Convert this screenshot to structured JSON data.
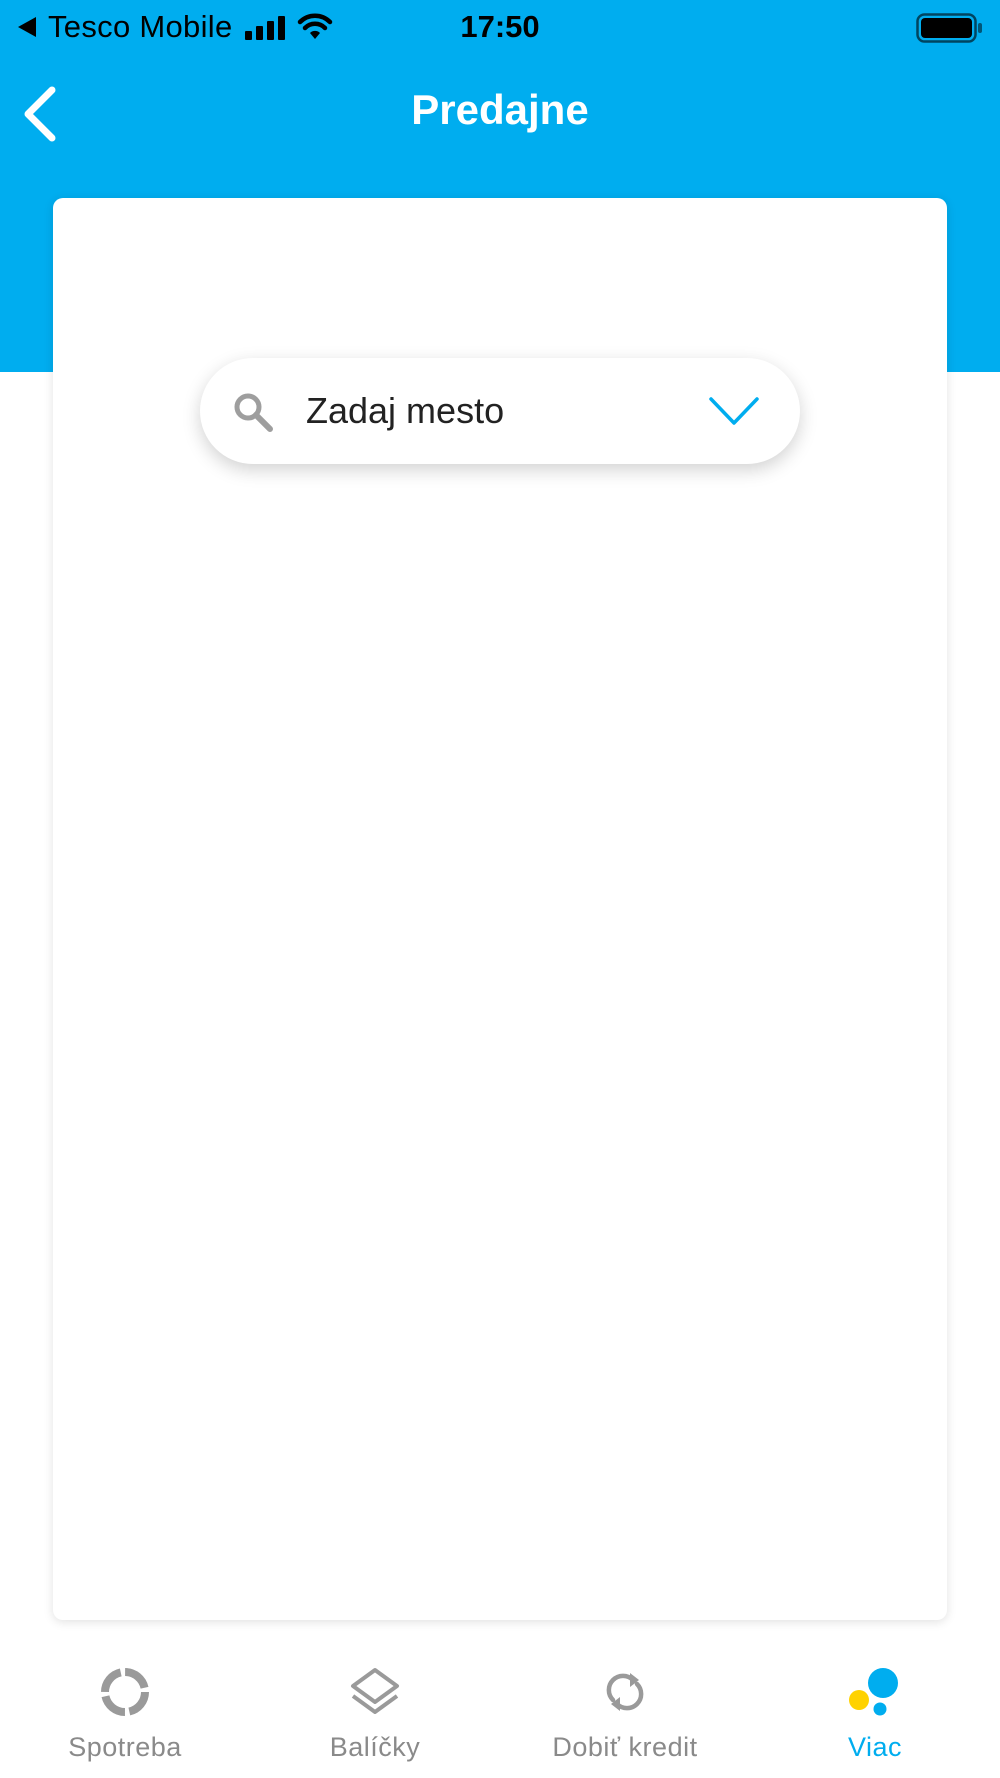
{
  "status_bar": {
    "carrier": "Tesco Mobile",
    "time": "17:50"
  },
  "nav": {
    "title": "Predajne",
    "back_icon": "chevron-left-icon"
  },
  "search": {
    "placeholder": "Zadaj mesto",
    "value": "",
    "icon": "search-icon",
    "dropdown_icon": "chevron-down-icon"
  },
  "tabs": [
    {
      "label": "Spotreba",
      "icon": "usage-ring-icon",
      "active": false
    },
    {
      "label": "Balíčky",
      "icon": "layers-icon",
      "active": false
    },
    {
      "label": "Dobiť kredit",
      "icon": "refresh-icon",
      "active": false
    },
    {
      "label": "Viac",
      "icon": "more-dots-icon",
      "active": true
    }
  ],
  "colors": {
    "brand_blue": "#00adef",
    "accent_yellow": "#ffd200",
    "inactive_gray": "#8a8a8a"
  }
}
